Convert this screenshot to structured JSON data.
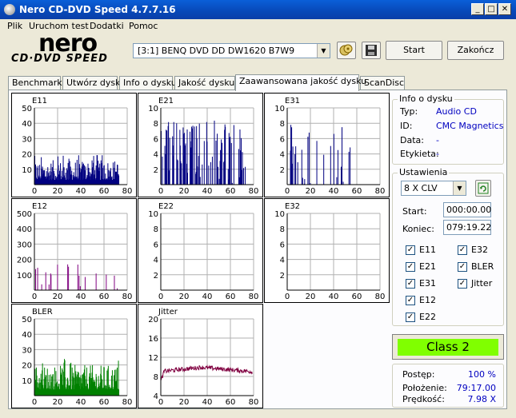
{
  "window": {
    "title": "Nero CD-DVD Speed 4.7.7.16",
    "min_label": "_",
    "max_label": "□",
    "close_label": "✕"
  },
  "menu": [
    "Plik",
    "Uruchom test",
    "Dodatki",
    "Pomoc"
  ],
  "logo": {
    "brand": "nero",
    "product": "CD·DVD SPEED"
  },
  "toolbar": {
    "drive": "[3:1]  BENQ DVD DD DW1620 B7W9",
    "start_label": "Start",
    "exit_label": "Zakończ",
    "disc_icon": "disc-info-icon",
    "save_icon": "floppy-save-icon"
  },
  "tabs": [
    "Benchmark",
    "Utwórz dysk",
    "Info o dysku",
    "Jakość dysku",
    "Zaawansowana jakość dysku",
    "ScanDisc"
  ],
  "active_tab": 4,
  "disc_info": {
    "title": "Info o dysku",
    "rows": [
      {
        "label": "Typ:",
        "value": "Audio CD"
      },
      {
        "label": "ID:",
        "value": "CMC Magnetics"
      },
      {
        "label": "Data:",
        "value": "-"
      },
      {
        "label": "Etykieta:",
        "value": "-"
      }
    ]
  },
  "settings": {
    "title": "Ustawienia",
    "speed": "8 X CLV",
    "start_label": "Start:",
    "start_value": "000:00.00",
    "end_label": "Koniec:",
    "end_value": "079:19.22",
    "checkboxes_left": [
      {
        "label": "E11",
        "checked": true
      },
      {
        "label": "E21",
        "checked": true
      },
      {
        "label": "E31",
        "checked": true
      },
      {
        "label": "E12",
        "checked": true
      },
      {
        "label": "E22",
        "checked": true
      }
    ],
    "checkboxes_right": [
      {
        "label": "E32",
        "checked": true
      },
      {
        "label": "BLER",
        "checked": true
      },
      {
        "label": "Jitter",
        "checked": true
      }
    ],
    "check_mark": "✓"
  },
  "result": {
    "class_label": "Class 2",
    "class_color": "#80ff00"
  },
  "status": {
    "progress_label": "Postęp:",
    "progress_value": "100 %",
    "position_label": "Położenie:",
    "position_value": "79:17.00",
    "speed_label": "Prędkość:",
    "speed_value": "7.98 X"
  },
  "chart_data": [
    {
      "name": "E11",
      "type": "bar",
      "color": "#000080",
      "xlim": [
        0,
        80
      ],
      "ylim": [
        0,
        50
      ],
      "yticks": [
        10,
        20,
        30,
        40,
        50
      ],
      "xticks": [
        0,
        20,
        40,
        60,
        80
      ],
      "profile": {
        "min": 3,
        "max": 16,
        "data_end": 73
      }
    },
    {
      "name": "E21",
      "type": "bar",
      "color": "#000080",
      "xlim": [
        0,
        80
      ],
      "ylim": [
        0,
        10
      ],
      "yticks": [
        2,
        4,
        6,
        8,
        10
      ],
      "xticks": [
        0,
        20,
        40,
        60,
        80
      ],
      "profile": {
        "min": 0,
        "max": 8.5,
        "data_end": 73,
        "sparse": 0.45
      }
    },
    {
      "name": "E31",
      "type": "bar",
      "color": "#000080",
      "xlim": [
        0,
        80
      ],
      "ylim": [
        0,
        10
      ],
      "yticks": [
        2,
        4,
        6,
        8,
        10
      ],
      "xticks": [
        0,
        20,
        40,
        60,
        80
      ],
      "profile": {
        "min": 0,
        "max": 8.5,
        "data_end": 60,
        "sparse": 0.12
      }
    },
    {
      "name": "E12",
      "type": "bar",
      "color": "#800080",
      "xlim": [
        0,
        80
      ],
      "ylim": [
        0,
        500
      ],
      "yticks": [
        100,
        200,
        300,
        400,
        500
      ],
      "xticks": [
        0,
        20,
        40,
        60,
        80
      ],
      "profile": {
        "min": 0,
        "max": 180,
        "data_end": 73,
        "sparse": 0.08
      }
    },
    {
      "name": "E22",
      "type": "bar",
      "color": "#000080",
      "xlim": [
        0,
        80
      ],
      "ylim": [
        0,
        10
      ],
      "yticks": [
        2,
        4,
        6,
        8,
        10
      ],
      "xticks": [
        0,
        20,
        40,
        60,
        80
      ],
      "profile": {
        "min": 0,
        "max": 0,
        "data_end": 0
      }
    },
    {
      "name": "E32",
      "type": "bar",
      "color": "#000080",
      "xlim": [
        0,
        80
      ],
      "ylim": [
        0,
        10
      ],
      "yticks": [
        2,
        4,
        6,
        8,
        10
      ],
      "xticks": [
        0,
        20,
        40,
        60,
        80
      ],
      "profile": {
        "min": 0,
        "max": 0,
        "data_end": 0
      }
    },
    {
      "name": "BLER",
      "type": "bar",
      "color": "#008000",
      "xlim": [
        0,
        80
      ],
      "ylim": [
        0,
        50
      ],
      "yticks": [
        10,
        20,
        30,
        40,
        50
      ],
      "xticks": [
        0,
        20,
        40,
        60,
        80
      ],
      "profile": {
        "min": 4,
        "max": 20,
        "data_end": 73
      }
    },
    {
      "name": "Jitter",
      "type": "line",
      "color": "#800040",
      "xlim": [
        0,
        80
      ],
      "ylim": [
        4,
        20
      ],
      "yticks": [
        4,
        8,
        12,
        16,
        20
      ],
      "xticks": [
        0,
        20,
        40,
        60,
        80
      ],
      "profile": {
        "start": 7.0,
        "plateau": 9.6,
        "end": 9.0,
        "data_end": 79
      }
    }
  ]
}
